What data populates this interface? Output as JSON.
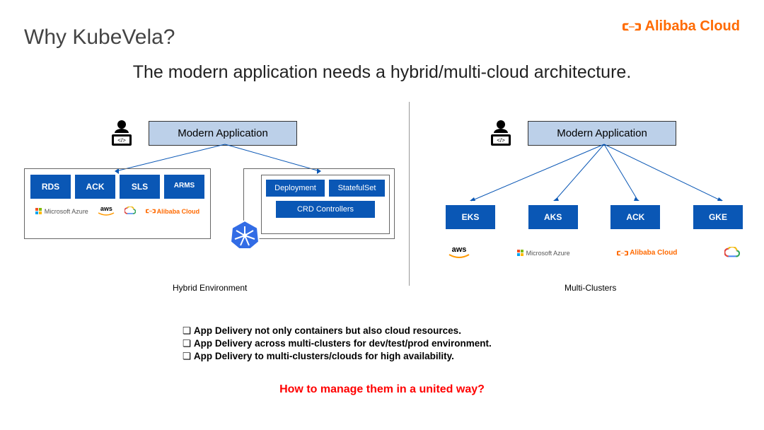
{
  "brand": "Alibaba Cloud",
  "title": "Why KubeVela?",
  "subtitle": "The modern application needs a hybrid/multi-cloud architecture.",
  "modern_app": "Modern Application",
  "left": {
    "services": [
      "RDS",
      "ACK",
      "SLS",
      "ARMS"
    ],
    "logos": {
      "azure": "Microsoft Azure",
      "aws": "aws",
      "gcp": "gcp",
      "alibaba": "Alibaba Cloud"
    },
    "k8s_box": {
      "deployment": "Deployment",
      "statefulset": "StatefulSet",
      "crd": "CRD Controllers"
    },
    "label": "Hybrid Environment"
  },
  "right": {
    "clusters": [
      "EKS",
      "AKS",
      "ACK",
      "GKE"
    ],
    "logos": {
      "aws": "aws",
      "azure": "Microsoft Azure",
      "alibaba": "Alibaba Cloud",
      "gcp": "gcp"
    },
    "label": "Multi-Clusters"
  },
  "bullets": [
    "App Delivery not only containers but also cloud resources.",
    "App Delivery across multi-clusters for dev/test/prod environment.",
    "App Delivery to multi-clusters/clouds for high availability."
  ],
  "question": "How to manage them in a united way?"
}
